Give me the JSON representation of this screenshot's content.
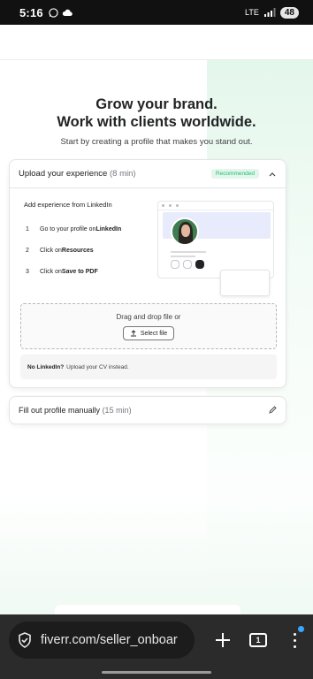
{
  "status": {
    "time": "5:16",
    "network": "LTE",
    "battery": "48"
  },
  "hero": {
    "title_line1": "Grow your brand.",
    "title_line2": "Work with clients worldwide.",
    "subtitle": "Start by creating a profile that makes you stand out."
  },
  "upload_card": {
    "title": "Upload your experience",
    "duration": "(8 min)",
    "badge": "Recommended",
    "linkedin_heading": "Add experience from LinkedIn",
    "steps": [
      {
        "num": "1",
        "text": "Go to your profile on ",
        "bold": "LinkedIn"
      },
      {
        "num": "2",
        "text": "Click on ",
        "bold": "Resources"
      },
      {
        "num": "3",
        "text": "Click on ",
        "bold": "Save to PDF"
      }
    ],
    "dropzone_text": "Drag and drop file or",
    "select_button": "Select file",
    "no_linkedin_bold": "No LinkedIn?",
    "no_linkedin_text": "Upload your CV instead."
  },
  "manual_card": {
    "title": "Fill out profile manually",
    "duration": "(15 min)"
  },
  "browser": {
    "url": "fiverr.com/seller_onboar",
    "tab_count": "1"
  },
  "colors": {
    "accent_green": "#1dbf73",
    "badge_bg": "#e3f6ec",
    "browser_bg": "#2b2b2b"
  },
  "icons": [
    "whatsapp-icon",
    "cloud-icon",
    "signal-icon",
    "chevron-up-icon",
    "upload-icon",
    "pencil-icon",
    "shield-icon",
    "plus-icon",
    "tabs-icon",
    "menu-icon"
  ]
}
